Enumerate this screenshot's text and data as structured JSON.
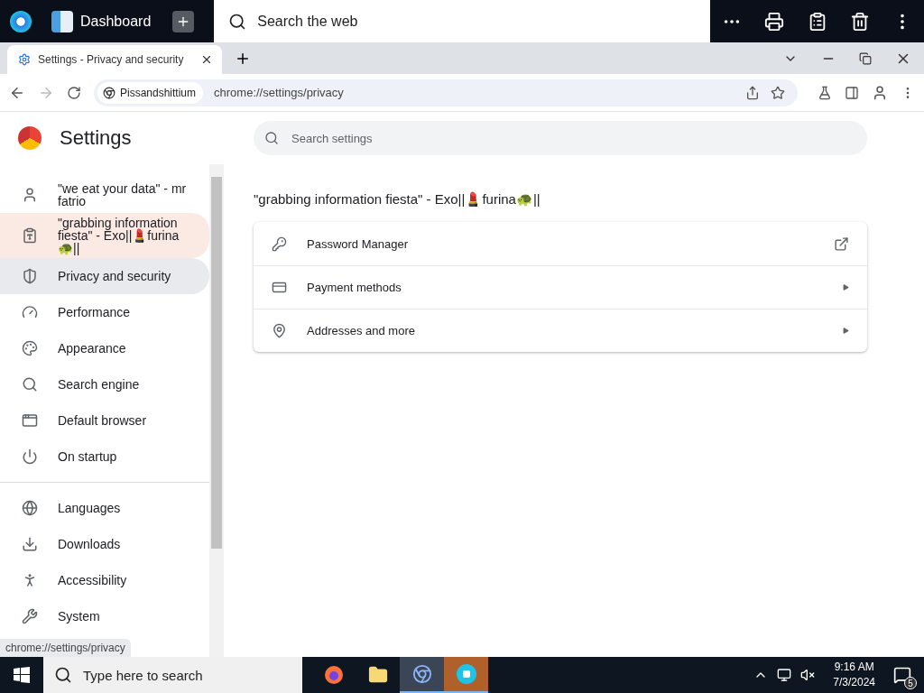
{
  "top_bar": {
    "app_title": "Dashboard",
    "search": {
      "placeholder": "Search the web"
    }
  },
  "browser": {
    "tabs": [
      {
        "title": "Settings - Privacy and security",
        "selected": true
      }
    ],
    "profile_chip": "Pissandshittium",
    "url": "chrome://settings/privacy"
  },
  "settings": {
    "title": "Settings",
    "search": {
      "placeholder": "Search settings"
    },
    "sidebar": [
      {
        "label": "\"we eat your data\" - mr fatrio",
        "selected": false,
        "hovered": false
      },
      {
        "label": "\"grabbing information fiesta\" - Exo||💄furina🐢||",
        "selected": false,
        "hovered": true
      },
      {
        "label": "Privacy and security",
        "selected": true,
        "hovered": false
      },
      {
        "label": "Performance",
        "selected": false,
        "hovered": false
      },
      {
        "label": "Appearance",
        "selected": false,
        "hovered": false
      },
      {
        "label": "Search engine",
        "selected": false,
        "hovered": false
      },
      {
        "label": "Default browser",
        "selected": false,
        "hovered": false
      },
      {
        "label": "On startup",
        "selected": false,
        "hovered": false
      },
      {
        "label": "Languages",
        "selected": false,
        "hovered": false,
        "divider_before": true
      },
      {
        "label": "Downloads",
        "selected": false,
        "hovered": false
      },
      {
        "label": "Accessibility",
        "selected": false,
        "hovered": false
      },
      {
        "label": "System",
        "selected": false,
        "hovered": false
      }
    ],
    "section_title": "\"grabbing information fiesta\" - Exo||💄furina🐢||",
    "rows": [
      {
        "label": "Password Manager",
        "kind": "external"
      },
      {
        "label": "Payment methods",
        "kind": "submenu"
      },
      {
        "label": "Addresses and more",
        "kind": "submenu"
      }
    ]
  },
  "status_link": "chrome://settings/privacy",
  "taskbar": {
    "search": {
      "placeholder": "Type here to search"
    },
    "time": "9:16 AM",
    "date": "7/3/2024",
    "notifications": "5"
  }
}
